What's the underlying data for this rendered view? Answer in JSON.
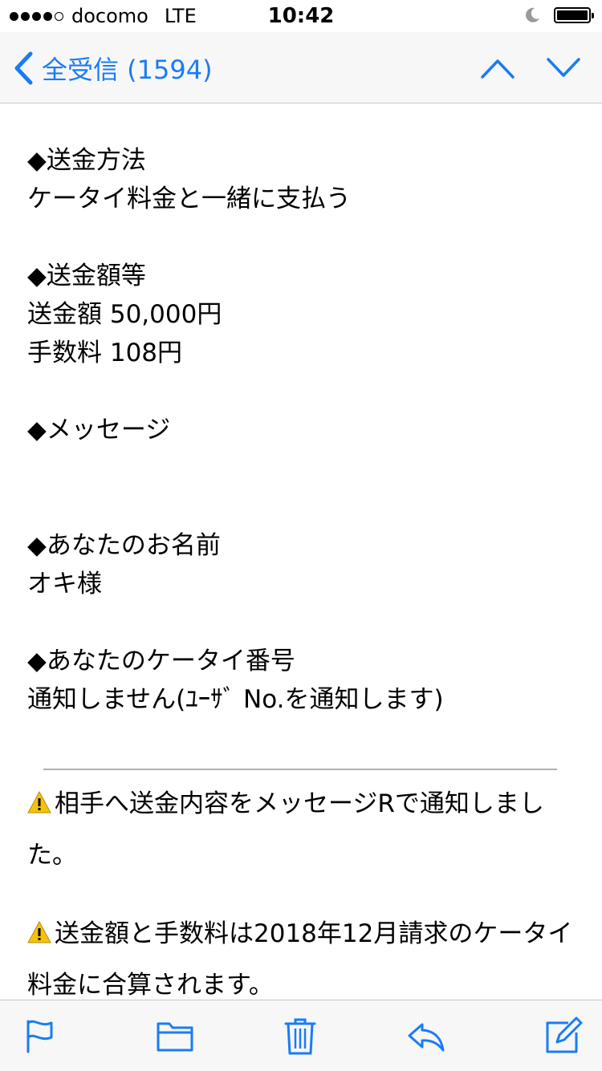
{
  "status_bar": {
    "carrier": "docomo",
    "network": "LTE",
    "time": "10:42"
  },
  "nav": {
    "back_label": "全受信 (1594)",
    "accent_color": "#1a7cf4"
  },
  "email": {
    "sections": [
      {
        "heading": "◆送金方法",
        "lines": [
          "ケータイ料金と一緒に支払う"
        ]
      },
      {
        "heading": "◆送金額等",
        "lines": [
          "送金額 50,000円",
          "手数料 108円"
        ]
      },
      {
        "heading": "◆メッセージ",
        "lines": []
      },
      {
        "heading": "◆あなたのお名前",
        "lines": [
          "オキ様"
        ]
      },
      {
        "heading": "◆あなたのケータイ番号",
        "lines": [
          "通知しません(ﾕｰｻﾞ No.を通知します)"
        ]
      }
    ],
    "notices": [
      "相手へ送金内容をメッセージRで通知しました。",
      "送金額と手数料は2018年12月請求のケータイ料金に合算されます。"
    ]
  },
  "toolbar": {
    "icons": [
      "flag-icon",
      "folder-icon",
      "trash-icon",
      "reply-icon",
      "compose-icon"
    ]
  }
}
